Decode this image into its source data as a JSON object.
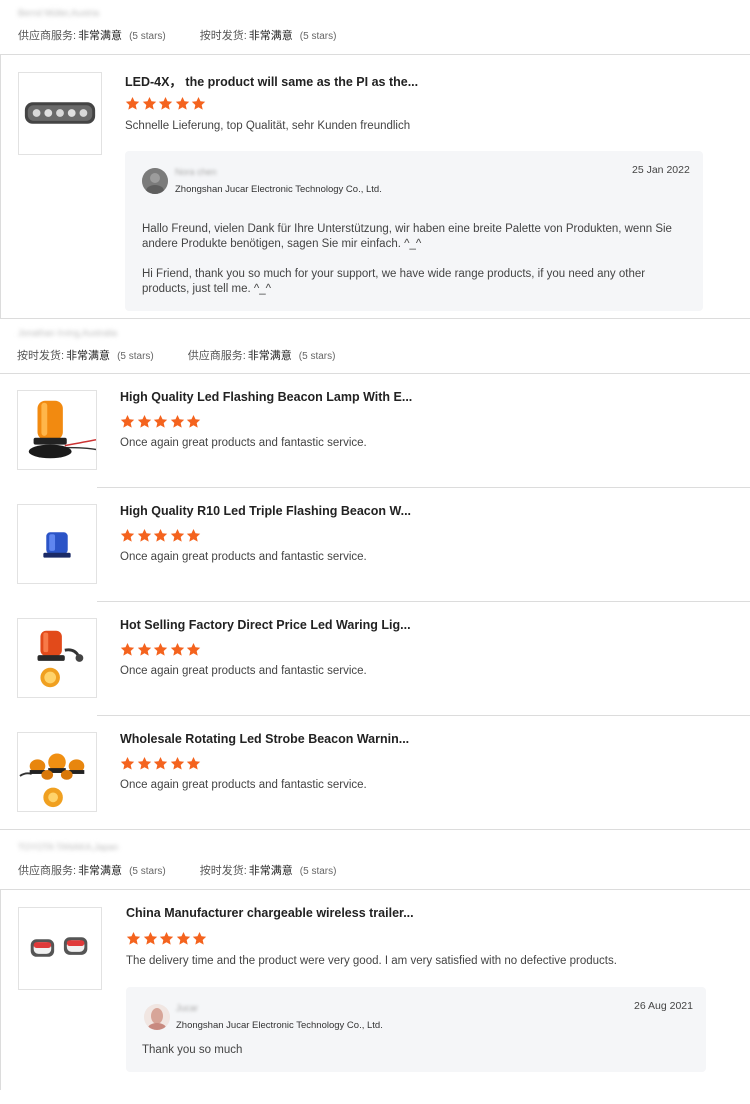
{
  "labels": {
    "supplier_service": "供应商服务:",
    "on_time_delivery": "按时发货:",
    "very_satisfied": "非常满意",
    "five_stars": "(5 stars)"
  },
  "colors": {
    "star": "#f4631e",
    "divider": "#dcdcdc",
    "reply_bg": "#f5f6f8"
  },
  "reviews": [
    {
      "buyer": "Bernd Müller,Austria",
      "product_title": "LED-4X， the product will same as the PI as the...",
      "rating": 5,
      "comment": "Schnelle Lieferung, top Qualität, sehr Kunden freundlich",
      "reply": {
        "name": "Nora chen",
        "company": "Zhongshan Jucar Electronic Technology Co., Ltd.",
        "date": "25 Jan 2022",
        "para1": "Hallo Freund, vielen Dank für Ihre Unterstützung, wir haben eine breite Palette von Produkten, wenn Sie andere Produkte benötigen, sagen Sie mir einfach. ^_^",
        "para2": "Hi Friend, thank you so much for your support, we have wide range products, if you need any other products, just tell me. ^_^"
      }
    },
    {
      "buyer": "Jonathan Irving,Australia",
      "items": [
        {
          "title": "High Quality Led Flashing Beacon Lamp With E...",
          "rating": 5,
          "comment": "Once again great products and fantastic service.",
          "icon": "amber-beacon-icon"
        },
        {
          "title": "High Quality R10 Led Triple Flashing Beacon W...",
          "rating": 5,
          "comment": "Once again great products and fantastic service.",
          "icon": "blue-beacon-icon"
        },
        {
          "title": "Hot Selling Factory Direct Price Led Waring Lig...",
          "rating": 5,
          "comment": "Once again great products and fantastic service.",
          "icon": "warning-light-icon"
        },
        {
          "title": "Wholesale Rotating Led Strobe Beacon Warnin...",
          "rating": 5,
          "comment": "Once again great products and fantastic service.",
          "icon": "strobe-beacon-icon"
        }
      ]
    },
    {
      "buyer": "TOYOTA TANAKA,Japan",
      "product_title": "China Manufacturer chargeable wireless trailer...",
      "rating": 5,
      "comment": "The delivery time and the product were very good. I am very satisfied with no defective products.",
      "reply": {
        "name": "Jucar",
        "company": "Zhongshan Jucar Electronic Technology Co., Ltd.",
        "date": "26 Aug 2021",
        "text": "Thank you so much"
      }
    }
  ]
}
